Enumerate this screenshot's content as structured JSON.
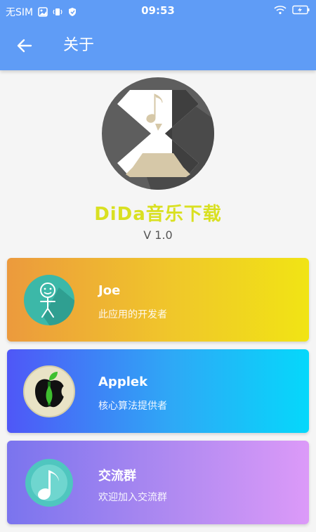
{
  "statusbar": {
    "carrier": "无SIM",
    "time": "09:53"
  },
  "toolbar": {
    "title": "关于",
    "back_icon": "arrow-left-icon"
  },
  "app": {
    "name": "DiDa音乐下载",
    "version": "V 1.0",
    "logo_icon": "hourglass-music-icon"
  },
  "cards": [
    {
      "title": "Joe",
      "subtitle": "此应用的开发者",
      "icon": "stick-figure-avatar"
    },
    {
      "title": "Applek",
      "subtitle": "核心算法提供者",
      "icon": "apple-avatar"
    },
    {
      "title": "交流群",
      "subtitle": "欢迎加入交流群",
      "icon": "music-note-avatar"
    }
  ],
  "colors": {
    "header": "#5f9cf6",
    "app_name": "#d9e021",
    "card1_start": "#ec9a3d",
    "card1_end": "#f1e414",
    "card2_start": "#4f57f7",
    "card2_end": "#05d8fb",
    "card3_start": "#7a74ee",
    "card3_end": "#dc9af8"
  }
}
